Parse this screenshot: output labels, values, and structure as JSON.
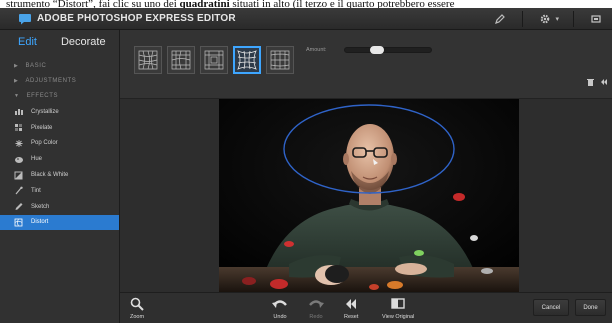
{
  "caption": {
    "before": "strumento “Distort”, fai clic su uno dei ",
    "bold": "quadratini",
    "after": " situati in alto (il terzo e il quarto potrebbero essere"
  },
  "app": {
    "title": "ADOBE PHOTOSHOP EXPRESS EDITOR",
    "window_icons": [
      "pen-icon",
      "gear-icon",
      "fullscreen-icon"
    ],
    "gear_caret": "▾"
  },
  "sidebar": {
    "tabs": {
      "edit": "Edit",
      "decorate": "Decorate"
    },
    "sections": {
      "basic": "BASIC",
      "adjustments": "ADJUSTMENTS",
      "effects": "EFFECTS"
    },
    "effects": [
      {
        "label": "Crystallize",
        "icon": "crystallize-icon"
      },
      {
        "label": "Pixelate",
        "icon": "pixelate-icon"
      },
      {
        "label": "Pop Color",
        "icon": "pop-color-icon"
      },
      {
        "label": "Hue",
        "icon": "hue-icon"
      },
      {
        "label": "Black & White",
        "icon": "black-white-icon"
      },
      {
        "label": "Tint",
        "icon": "tint-icon"
      },
      {
        "label": "Sketch",
        "icon": "sketch-icon"
      },
      {
        "label": "Distort",
        "icon": "distort-icon",
        "selected": true
      }
    ]
  },
  "toolbar": {
    "amount_label": "Amount:",
    "amount_value": 0.35,
    "selected_thumb": 4,
    "thumb_count": 5
  },
  "bottom": {
    "zoom": "Zoom",
    "undo": "Undo",
    "redo": "Redo",
    "reset": "Reset",
    "view_original": "View Original",
    "cancel": "Cancel",
    "done": "Done"
  },
  "colors": {
    "accent": "#3ea6ff",
    "selected_row": "#2b7bd0",
    "panel": "#313131",
    "ellipse": "#2f63c8"
  }
}
